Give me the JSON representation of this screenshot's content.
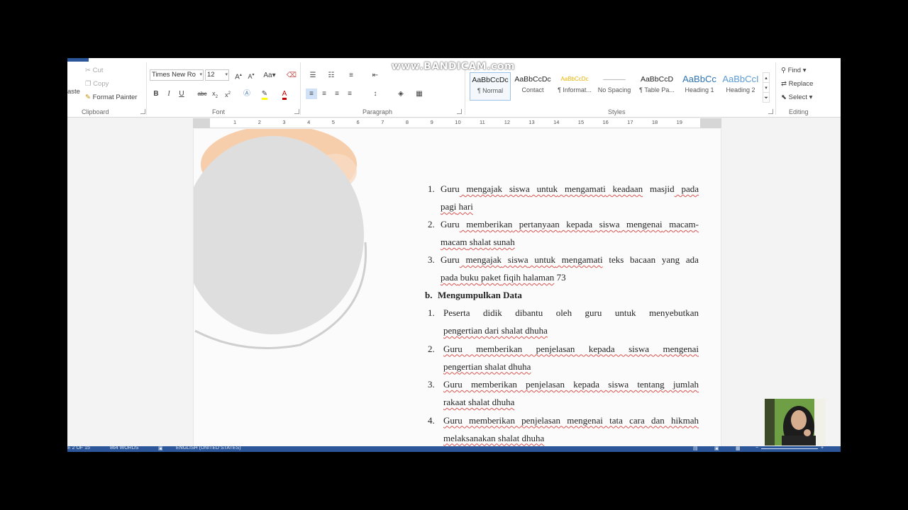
{
  "watermark": "www.BANDICAM.com",
  "clipboard": {
    "cut": "Cut",
    "copy": "Copy",
    "paste_fragment": "aste",
    "format_painter": "Format Painter",
    "label": "Clipboard"
  },
  "font": {
    "family": "Times New Ro",
    "size": "12",
    "grow": "A",
    "shrink": "A",
    "change_case": "Aa",
    "bold": "B",
    "italic": "I",
    "underline": "U",
    "strike": "abc",
    "subscript": "x",
    "superscript": "x",
    "label": "Font"
  },
  "paragraph": {
    "label": "Paragraph"
  },
  "styles": {
    "label": "Styles",
    "items": [
      {
        "preview": "AaBbCcDc",
        "name": "¶ Normal",
        "color": "#222222"
      },
      {
        "preview": "AaBbCcDc",
        "name": "Contact",
        "color": "#222222"
      },
      {
        "preview": "AaBbCcDc",
        "name": "¶ Informat...",
        "color": "#e8b200"
      },
      {
        "preview": "———",
        "name": "No Spacing",
        "color": "#999999"
      },
      {
        "preview": "AaBbCcD",
        "name": "¶ Table Pa...",
        "color": "#222222"
      },
      {
        "preview": "AaBbCc",
        "name": "Heading 1",
        "color": "#2e74b5"
      },
      {
        "preview": "AaBbCcI",
        "name": "Heading 2",
        "color": "#5b9bd5"
      }
    ]
  },
  "editing": {
    "find": "Find",
    "replace": "Replace",
    "select": "Select",
    "label": "Editing"
  },
  "ruler": [
    "1",
    "2",
    "3",
    "4",
    "5",
    "6",
    "7",
    "8",
    "9",
    "10",
    "11",
    "12",
    "13",
    "14",
    "15",
    "16",
    "17",
    "18",
    "19"
  ],
  "document": {
    "list_a": [
      {
        "num": "1.",
        "line1": [
          "Guru",
          " mengajak",
          " siswa",
          " untuk",
          " mengamati",
          " keadaan",
          " masjid",
          " pada"
        ],
        "line2": [
          "pagi",
          " hari"
        ]
      },
      {
        "num": "2.",
        "line1": [
          "Guru",
          " memberikan",
          " pertanyaan",
          " kepada",
          " siswa",
          " mengenai",
          " macam-"
        ],
        "line2": [
          "macam",
          " shalat",
          " sunah"
        ]
      },
      {
        "num": "3.",
        "line1": [
          "Guru",
          " mengajak",
          " siswa",
          " untuk",
          " mengamati",
          " teks",
          " bacaan",
          " yang",
          " ada"
        ],
        "line2": [
          "pada",
          " buku",
          " paket",
          " fiqih",
          " halaman",
          " 73"
        ]
      }
    ],
    "heading": {
      "letter": "b.",
      "text": "Mengumpulkan Data"
    },
    "list_b": [
      {
        "num": "1.",
        "line1": "Peserta didik dibantu oleh guru untuk menyebutkan",
        "line2": "pengertian dari shalat dhuha"
      },
      {
        "num": "2.",
        "line1": "Guru memberikan penjelasan kepada siswa mengenai",
        "line2": "pengertian shalat dhuha"
      },
      {
        "num": "3.",
        "line1": "Guru memberikan penjelasan kepada siswa tentang jumlah",
        "line2": "rakaat shalat dhuha"
      },
      {
        "num": "4.",
        "line1": "Guru memberikan penjelasan mengenai tata cara dan hikmah",
        "line2": "melaksanakan shalat dhuha"
      }
    ]
  },
  "status": {
    "page": "E 2 OF 15",
    "words": "864 WORDS",
    "language": "ENGLISH (UNITED STATES)"
  }
}
